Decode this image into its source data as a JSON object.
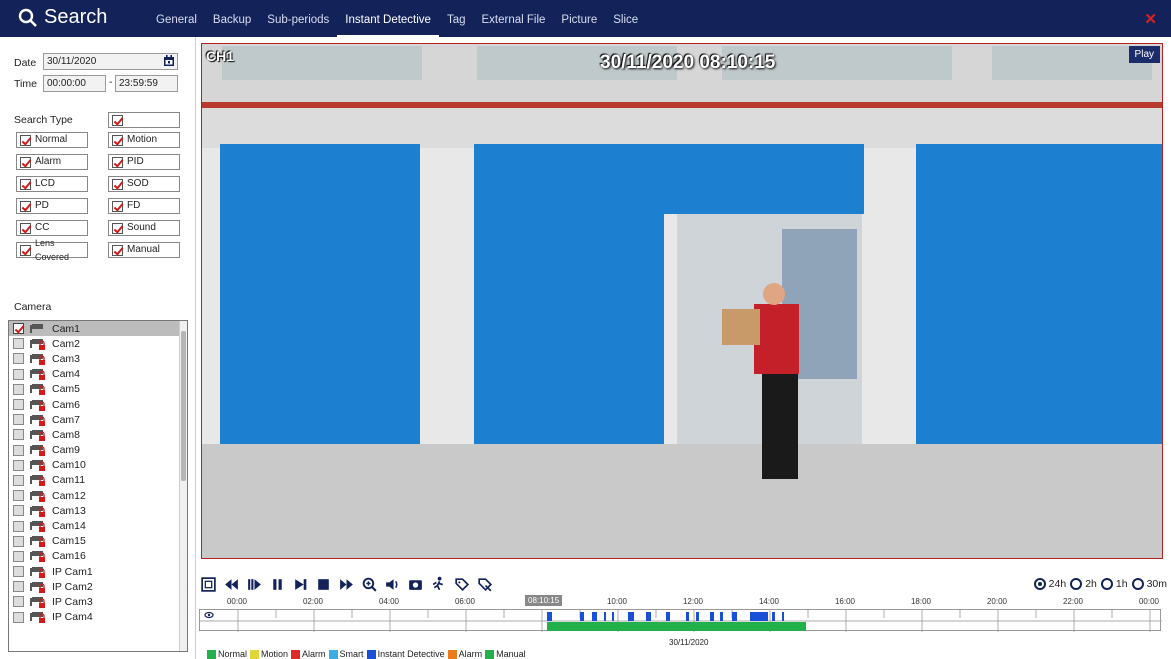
{
  "header": {
    "title": "Search",
    "tabs": [
      "General",
      "Backup",
      "Sub-periods",
      "Instant Detective",
      "Tag",
      "External File",
      "Picture",
      "Slice"
    ],
    "active_tab": "Instant Detective",
    "close": "✕"
  },
  "filters": {
    "date_label": "Date",
    "date_value": "30/11/2020",
    "time_label": "Time",
    "time_start": "00:00:00",
    "time_sep": "-",
    "time_end": "23:59:59",
    "search_type_label": "Search Type",
    "types": [
      {
        "label": "Normal",
        "checked": true
      },
      {
        "label": "Motion",
        "checked": true
      },
      {
        "label": "Alarm",
        "checked": true
      },
      {
        "label": "PID",
        "checked": true
      },
      {
        "label": "LCD",
        "checked": true
      },
      {
        "label": "SOD",
        "checked": true
      },
      {
        "label": "PD",
        "checked": true
      },
      {
        "label": "FD",
        "checked": true
      },
      {
        "label": "CC",
        "checked": true
      },
      {
        "label": "Sound",
        "checked": true
      },
      {
        "label": "Lens Covered",
        "checked": true
      },
      {
        "label": "Manual",
        "checked": true
      }
    ]
  },
  "camera": {
    "label": "Camera",
    "items": [
      "Cam1",
      "Cam2",
      "Cam3",
      "Cam4",
      "Cam5",
      "Cam6",
      "Cam7",
      "Cam8",
      "Cam9",
      "Cam10",
      "Cam11",
      "Cam12",
      "Cam13",
      "Cam14",
      "Cam15",
      "Cam16",
      "IP Cam1",
      "IP Cam2",
      "IP Cam3",
      "IP Cam4"
    ],
    "selected": "Cam1"
  },
  "video": {
    "channel": "CH1",
    "osd_time": "30/11/2020 08:10:15",
    "status": "Play"
  },
  "controls": {
    "icons": [
      "fullscreen-icon",
      "rewind-icon",
      "slow-play-icon",
      "pause-icon",
      "step-forward-icon",
      "stop-icon",
      "fast-forward-icon",
      "zoom-icon",
      "volume-icon",
      "snapshot-icon",
      "smart-search-icon",
      "tag-icon",
      "tag-edit-icon"
    ],
    "ranges": [
      "24h",
      "2h",
      "1h",
      "30m"
    ],
    "selected_range": "24h"
  },
  "timeline": {
    "ticks": [
      "00:00",
      "02:00",
      "04:00",
      "06:00",
      "08:10:15",
      "10:00",
      "12:00",
      "14:00",
      "16:00",
      "18:00",
      "20:00",
      "22:00",
      "00:00"
    ],
    "cursor": "08:10:15",
    "date": "30/11/2020",
    "legend": [
      {
        "label": "Normal",
        "color": "#22b04a"
      },
      {
        "label": "Motion",
        "color": "#e0d63a"
      },
      {
        "label": "Alarm",
        "color": "#e02a2a"
      },
      {
        "label": "Smart",
        "color": "#3aaee0"
      },
      {
        "label": "Instant Detective",
        "color": "#1a4fd8"
      },
      {
        "label": "Alarm",
        "color": "#ec7a1a"
      },
      {
        "label": "Manual",
        "color": "#22b04a"
      }
    ]
  }
}
